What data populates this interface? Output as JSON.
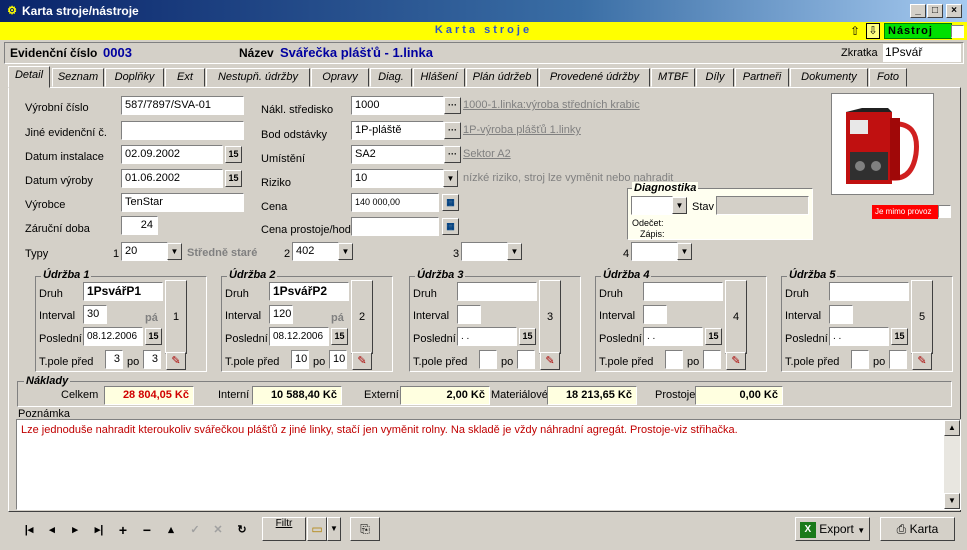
{
  "window": {
    "title": "Karta stroje/nástroje",
    "app_icon": "app-icon"
  },
  "banner": {
    "caption": "Karta stroje",
    "nastroj_label": "Nástroj"
  },
  "header": {
    "evid_label": "Evidenční číslo",
    "evid_value": "0003",
    "nazev_label": "Název",
    "nazev_value": "Svářečka plášťů - 1.linka",
    "zkratka_label": "Zkratka",
    "zkratka_value": "1Psvář"
  },
  "tabs": [
    "Detail",
    "Seznam",
    "Doplňky",
    "Ext",
    "Nestupň. údržby",
    "Opravy",
    "Diag.",
    "Hlášení",
    "Plán údržeb",
    "Provedené údržby",
    "MTBF",
    "Díly",
    "Partneři",
    "Dokumenty",
    "Foto"
  ],
  "detail": {
    "vyrobni_cislo": {
      "label": "Výrobní číslo",
      "value": "587/7897/SVA-01"
    },
    "jine_evid": {
      "label": "Jiné evidenční č.",
      "value": ""
    },
    "datum_instalace": {
      "label": "Datum instalace",
      "value": "02.09.2002"
    },
    "datum_vyroby": {
      "label": "Datum výroby",
      "value": "01.06.2002"
    },
    "vyrobce": {
      "label": "Výrobce",
      "value": "TenStar"
    },
    "zarucni_doba": {
      "label": "Záruční doba",
      "value": "24"
    },
    "nakl_stredisko": {
      "label": "Nákl. středisko",
      "value": "1000",
      "link": "1000-1.linka:výroba středních krabic"
    },
    "bod_odstavky": {
      "label": "Bod odstávky",
      "value": "1P-pláště",
      "link": "1P-výroba plášťů 1.linky"
    },
    "umisteni": {
      "label": "Umístění",
      "value": "SA2",
      "link": "Sektor A2"
    },
    "riziko": {
      "label": "Riziko",
      "value": "10",
      "desc": "nízké riziko, stroj lze vyměnit nebo nahradit"
    },
    "cena": {
      "label": "Cena",
      "value": "140 000,00"
    },
    "cena_prostoje": {
      "label": "Cena prostoje/hod",
      "value": ""
    },
    "typy": {
      "label": "Typy",
      "n1": "1",
      "v1": "20",
      "desc1": "Středně staré",
      "n2": "2",
      "v2": "402",
      "n3": "3",
      "v3": "",
      "n4": "4",
      "v4": ""
    },
    "diagnostika": {
      "title": "Diagnostika",
      "stav_label": "Stav",
      "odecet_label": "Odečet:",
      "zapis_label": "Zápis:"
    },
    "mimo_provoz": "Je mimo provoz"
  },
  "udrzba": [
    {
      "title": "Údržba 1",
      "druh": "1PsvářP1",
      "interval": "30",
      "unit": "pá",
      "posledni": "08.12.2006",
      "pred": "3",
      "po": "3",
      "num": "1"
    },
    {
      "title": "Údržba 2",
      "druh": "1PsvářP2",
      "interval": "120",
      "unit": "pá",
      "posledni": "08.12.2006",
      "pred": "10",
      "po": "10",
      "num": "2"
    },
    {
      "title": "Údržba 3",
      "druh": "",
      "interval": "",
      "unit": "",
      "posledni": ". .",
      "pred": "",
      "po": "",
      "num": "3"
    },
    {
      "title": "Údržba 4",
      "druh": "",
      "interval": "",
      "unit": "",
      "posledni": ". .",
      "pred": "",
      "po": "",
      "num": "4"
    },
    {
      "title": "Údržba 5",
      "druh": "",
      "interval": "",
      "unit": "",
      "posledni": ". .",
      "pred": "",
      "po": "",
      "num": "5"
    }
  ],
  "udrzba_labels": {
    "druh": "Druh",
    "interval": "Interval",
    "posledni": "Poslední",
    "tpole": "T.pole před",
    "po": "po"
  },
  "naklady": {
    "title": "Náklady",
    "celkem_label": "Celkem",
    "celkem": "28 804,05 Kč",
    "interni_label": "Interní",
    "interni": "10 588,40 Kč",
    "externi_label": "Externí",
    "externi": "2,00 Kč",
    "materialove_label": "Materiálové",
    "materialove": "18 213,65 Kč",
    "prostoje_label": "Prostoje",
    "prostoje": "0,00 Kč"
  },
  "poznamka": {
    "label": "Poznámka",
    "text": "Lze jednoduše nahradit kteroukoliv svářečkou plášťů z jiné linky, stačí jen vyměnit rolny. Na skladě je vždy náhradní agregát. Prostoje-viz střihačka."
  },
  "toolbar": {
    "filtr": "Filtr",
    "export": "Export",
    "karta": "Karta"
  },
  "colors": {
    "title_bar": "#0a246a",
    "banner": "#ffff00",
    "nastroj": "#00e000",
    "value_blue": "#0000a0",
    "note_red": "#c00000"
  }
}
